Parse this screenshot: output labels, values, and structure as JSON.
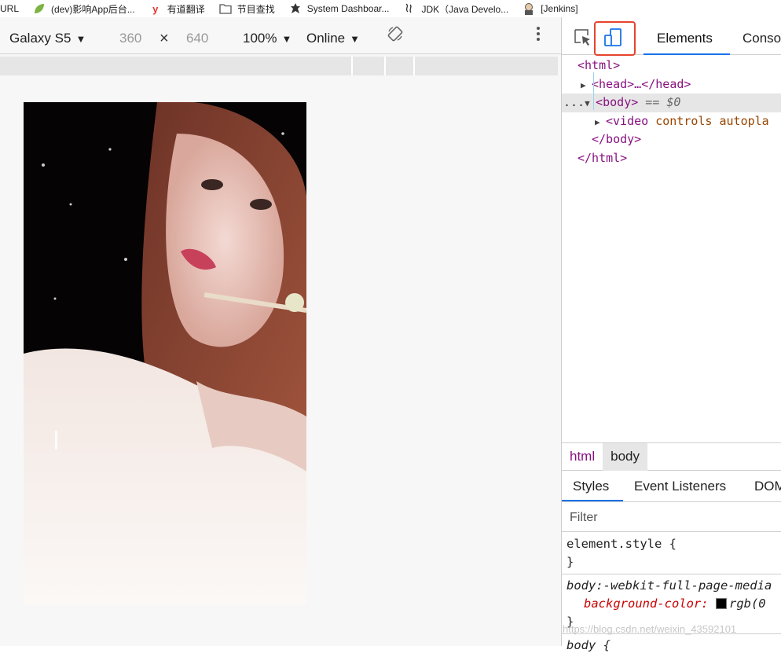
{
  "bookmarks": [
    {
      "label": "URL",
      "icon": "none"
    },
    {
      "label": "(dev)影响App后台...",
      "icon": "leaf-icon"
    },
    {
      "label": "有道翻译",
      "icon": "youdao-icon"
    },
    {
      "label": "节目查找",
      "icon": "folder-icon"
    },
    {
      "label": "System Dashboar...",
      "icon": "dashboard-icon"
    },
    {
      "label": "JDK（Java Develo...",
      "icon": "jdk-icon"
    },
    {
      "label": "[Jenkins]",
      "icon": "jenkins-icon"
    }
  ],
  "device_toolbar": {
    "device": "Galaxy S5",
    "width": "360",
    "times": "×",
    "height": "640",
    "zoom": "100%",
    "network": "Online"
  },
  "devtools": {
    "tabs": [
      "Elements",
      "Conso"
    ],
    "dom": {
      "html_open": "<html>",
      "head_line": "<head>…</head>",
      "body_ellipsis": "...",
      "body_open": "<body>",
      "body_eq": " == $0",
      "video_tag": "<video",
      "video_attrs": " controls autopla",
      "body_close": "</body>",
      "html_close": "</html>"
    },
    "breadcrumbs": [
      "html",
      "body"
    ],
    "subtabs": [
      "Styles",
      "Event Listeners",
      "DOM"
    ],
    "filter_placeholder": "Filter",
    "styles": {
      "rule1_selector": "element.style {",
      "rule1_close": "}",
      "rule2_selector": "body:-webkit-full-page-media",
      "rule2_prop": "background-color:",
      "rule2_value": "rgb(0",
      "rule2_close": "}",
      "rule3_selector": "body {"
    }
  },
  "watermark": "https://blog.csdn.net/weixin_43592101",
  "colors": {
    "highlight_box": "#e6442c",
    "active_tab": "#1a73e8",
    "tag": "#881280"
  }
}
